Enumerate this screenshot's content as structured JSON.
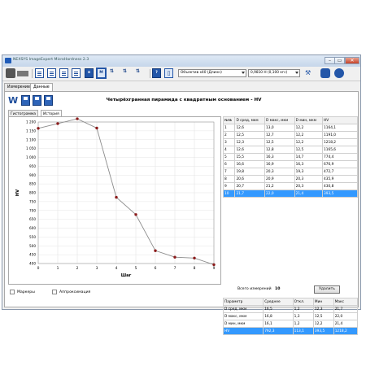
{
  "window": {
    "title": "NEXSYS ImageExpert MicroHardness 2.3"
  },
  "toolbar": {
    "icons": [
      "camera-icon",
      "scanner-icon",
      "document-icon",
      "document-icon",
      "document-icon",
      "document-icon",
      "list-icon",
      "measure-icon",
      "measure-auto-icon",
      "measure-next-icon",
      "measure-last-icon",
      "help-icon",
      "pointer-icon"
    ],
    "objective_label": "Объектив x40 (Длинн)",
    "load_label": "0,9810 Н   (0,100 кгс)"
  },
  "tabs": [
    "Измерение",
    "Данные"
  ],
  "active_tab": 1,
  "chart_tabs": [
    "Гистограмма",
    "История"
  ],
  "active_chart_tab": 1,
  "chart_title": "Четырёхгранная пирамида с квадратным основанием - HV",
  "chart_data": {
    "type": "line",
    "x": [
      0,
      1,
      2,
      3,
      4,
      5,
      6,
      7,
      8,
      9
    ],
    "series": [
      {
        "values": [
          1164.1,
          1191.0,
          1218.2,
          1165.6,
          774.4,
          676.9,
          472.7,
          435.9,
          430.8,
          393.5
        ]
      }
    ],
    "xlabel": "Шаг",
    "ylabel": "HV",
    "xlim": [
      0,
      9
    ],
    "ylim": [
      400,
      1200
    ],
    "y_ticks": [
      400,
      450,
      500,
      550,
      600,
      650,
      700,
      750,
      800,
      850,
      900,
      950,
      1000,
      1050,
      1100,
      1150,
      1200
    ],
    "x_ticks": [
      0,
      1,
      2,
      3,
      4,
      5,
      6,
      7,
      8,
      9
    ],
    "y_tick_labels": [
      "400",
      "450",
      "500",
      "550",
      "600",
      "650",
      "700",
      "750",
      "800",
      "850",
      "900",
      "950",
      "1 000",
      "1 050",
      "1 100",
      "1 150",
      "1 200"
    ],
    "grid": true,
    "colors": {
      "line": "#8c8c8c",
      "marker": "#8b1a1a"
    }
  },
  "checkboxes": [
    {
      "label": "Маркеры",
      "checked": false
    },
    {
      "label": "Аппроксимация",
      "checked": false
    }
  ],
  "measurements": {
    "headers": [
      "№№",
      "D сред, мкм",
      "D макс, мкм",
      "D мин, мкм",
      "HV"
    ],
    "rows": [
      [
        "1",
        "12,6",
        "13,0",
        "12,2",
        "1164,1"
      ],
      [
        "2",
        "12,5",
        "12,7",
        "12,2",
        "1191,0"
      ],
      [
        "3",
        "12,3",
        "12,5",
        "12,2",
        "1218,2"
      ],
      [
        "4",
        "12,6",
        "12,8",
        "12,5",
        "1165,6"
      ],
      [
        "5",
        "15,5",
        "16,3",
        "14,7",
        "774,4"
      ],
      [
        "6",
        "16,6",
        "16,9",
        "16,3",
        "676,9"
      ],
      [
        "7",
        "19,8",
        "20,3",
        "19,3",
        "472,7"
      ],
      [
        "8",
        "20,6",
        "20,9",
        "20,3",
        "435,9"
      ],
      [
        "9",
        "20,7",
        "21,2",
        "20,3",
        "430,8"
      ],
      [
        "10",
        "21,7",
        "22,0",
        "21,4",
        "393,5"
      ]
    ],
    "selected_row": 9
  },
  "count_label": "Всего измерений",
  "count_value": "10",
  "delete_label": "Удалить",
  "stats": {
    "headers": [
      "Параметр",
      "Среднее",
      "Откл.",
      "Мин",
      "Макс"
    ],
    "rows": [
      [
        "D сред, мкм",
        "16,5",
        "1,2",
        "12,3",
        "21,7"
      ],
      [
        "D макс, мкм",
        "16,8",
        "1,3",
        "12,5",
        "22,0"
      ],
      [
        "D мин, мкм",
        "16,1",
        "1,2",
        "12,2",
        "21,4"
      ],
      [
        "HV",
        "792,3",
        "113,1",
        "393,5",
        "1218,2"
      ]
    ],
    "selected_row": 3
  }
}
